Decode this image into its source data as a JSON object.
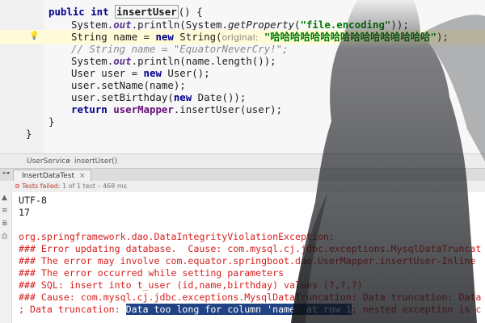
{
  "editor": {
    "method_signature": {
      "keywords": "public int",
      "name": "insertUser",
      "suffix": "() {"
    },
    "line2": {
      "prefix": "System.",
      "field": "out",
      "middle": ".println(System.",
      "method": "getProperty",
      "open": "(",
      "string": "\"file.encoding\"",
      "close": "));"
    },
    "line3": {
      "prefix": "String name = ",
      "kw": "new",
      "call": " String(",
      "hint": "original:",
      "string": "\"哈哈哈哈哈哈哈哈哈哈哈哈哈哈哈哈\"",
      "close": ");"
    },
    "line4": {
      "comment": "// String name = \"EquatorNeverCry!\";"
    },
    "line5": {
      "prefix": "System.",
      "field": "out",
      "rest": ".println(name.length());"
    },
    "line6": {
      "prefix": "User user = ",
      "kw": "new",
      "rest": " User();"
    },
    "line7": {
      "text": "user.setName(name);"
    },
    "line8": {
      "prefix": "user.setBirthday(",
      "kw": "new",
      "rest": " Date());"
    },
    "line9": {
      "kw": "return",
      "obj": " userMapper",
      "rest": ".insertUser(user);"
    },
    "brace_inner": "}",
    "brace_outer": "}"
  },
  "breadcrumb": {
    "class_name": "UserService",
    "separator": "›",
    "method_name": "insertUser()"
  },
  "run_panel": {
    "tab_label": "InsertDataTest",
    "tab_close": "×",
    "status": {
      "failed": "Tests failed:",
      "detail": "1 of 1 test – 468 ms"
    }
  },
  "console": {
    "lines": [
      "UTF-8",
      "17",
      "",
      "org.springframework.dao.DataIntegrityViolationException:",
      "### Error updating database.  Cause: com.mysql.cj.jdbc.exceptions.MysqlDataTruncat",
      "### The error may involve com.equator.springboot.dao.UserMapper.insertUser-Inline",
      "### The error occurred while setting parameters",
      "### SQL: insert into t_user (id,name,birthday) values (?,?,?)",
      "### Cause: com.mysql.cj.jdbc.exceptions.MysqlDataTruncation: Data truncation: Data"
    ],
    "last_line": {
      "before": "; Data truncation: ",
      "selected": "Data too long for column 'name' at row 1",
      "after": "; nested exception is c"
    }
  },
  "colors": {
    "keyword": "#00008b",
    "string": "#007a00",
    "error": "#d61f1f",
    "selection": "#214283"
  }
}
